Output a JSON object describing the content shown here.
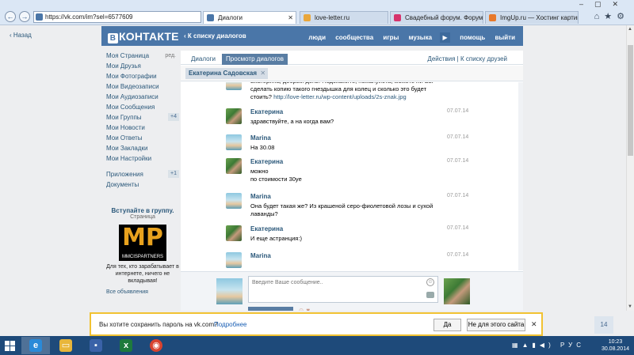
{
  "browser": {
    "address": "https://vk.com/im?sel=6577609",
    "tabs": [
      {
        "title": "Диалоги",
        "active": true,
        "color": "#4a76a8"
      },
      {
        "title": "love-letter.ru",
        "active": false,
        "color": "#e9a63b"
      },
      {
        "title": "Свадебный форум. Форум не...",
        "active": false,
        "color": "#d6336c"
      },
      {
        "title": "ImgUp.ru — Хостинг картинок",
        "active": false,
        "color": "#e8792b"
      }
    ]
  },
  "page": {
    "back": "Назад"
  },
  "vk_header": {
    "logo": "КОНТАКТЕ",
    "logo_b": "В",
    "to_dialogs": "‹ К списку диалогов",
    "nav": [
      "люди",
      "сообщества",
      "игры",
      "музыка",
      "помощь",
      "выйти"
    ],
    "brand_color": "#4a76a8"
  },
  "left_menu": {
    "items": [
      {
        "label": "Моя Страница",
        "extra": "ред."
      },
      {
        "label": "Мои Друзья"
      },
      {
        "label": "Мои Фотографии"
      },
      {
        "label": "Мои Видеозаписи"
      },
      {
        "label": "Мои Аудиозаписи"
      },
      {
        "label": "Мои Сообщения"
      },
      {
        "label": "Мои Группы",
        "badge": "+4"
      },
      {
        "label": "Мои Новости"
      },
      {
        "label": "Мои Ответы"
      },
      {
        "label": "Мои Закладки"
      },
      {
        "label": "Мои Настройки"
      },
      {
        "label": "Приложения",
        "badge": "+1"
      },
      {
        "label": "Документы"
      }
    ],
    "promo": {
      "title": "Вступайте в группу.",
      "subtitle": "Страница",
      "logo_letters": "MP",
      "logo_name": "MMCISPARTNERS",
      "text": "Для тех, кто зарабатывает в интернете, ничего не вкладывая!",
      "more": "Все объявления"
    }
  },
  "main": {
    "tabs": [
      "Диалоги",
      "Просмотр диалогов"
    ],
    "right_links": "Действия  |  К списку друзей",
    "peer": "Екатерина Садовская",
    "messages": [
      {
        "author": "",
        "date": "",
        "lines": [
          "Екатерина, добрый день! Подскажите, пожалуйста, можете ли Вы",
          "сделать копию такого гнездышка для колец и сколько это будет",
          "стоить?"
        ],
        "link": "http://love-letter.ru/wp-content/uploads/2s-znak.jpg",
        "avatar": "m"
      },
      {
        "author": "Екатерина",
        "date": "07.07.14",
        "lines": [
          "здравствуйте, а на когда вам?"
        ],
        "avatar": "f"
      },
      {
        "author": "Marina",
        "date": "07.07.14",
        "lines": [
          "На 30.08"
        ],
        "avatar": "m"
      },
      {
        "author": "Екатерина",
        "date": "07.07.14",
        "lines": [
          "можно",
          "по стоимости 30уе"
        ],
        "avatar": "f"
      },
      {
        "author": "Marina",
        "date": "07.07.14",
        "lines": [
          "Она будет такая же? Из крашеной серо-фиолетовой лозы и сухой",
          "лаванды?"
        ],
        "avatar": "m"
      },
      {
        "author": "Екатерина",
        "date": "07.07.14",
        "lines": [
          "И еще астранция:)"
        ],
        "avatar": "f"
      },
      {
        "author": "Marina",
        "date": "07.07.14",
        "lines": [],
        "avatar": "m"
      }
    ],
    "compose_placeholder": "Введите Ваше сообщение.."
  },
  "password_bar": {
    "question": "Вы хотите сохранить пароль на vk.com?",
    "more": "Подробнее",
    "yes": "Да",
    "no": "Не для этого сайта"
  },
  "notif_count": "14",
  "taskbar": {
    "lang": "РУС",
    "time": "10:23",
    "date": "30.08.2014"
  }
}
